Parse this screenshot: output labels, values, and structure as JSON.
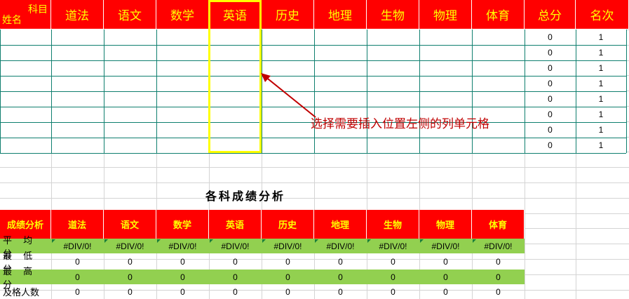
{
  "top_table": {
    "corner_top": "科目",
    "corner_bottom": "姓名",
    "headers": [
      "道法",
      "语文",
      "数学",
      "英语",
      "历史",
      "地理",
      "生物",
      "物理",
      "体育",
      "总分",
      "名次"
    ],
    "rows": [
      {
        "total": "0",
        "rank": "1"
      },
      {
        "total": "0",
        "rank": "1"
      },
      {
        "total": "0",
        "rank": "1"
      },
      {
        "total": "0",
        "rank": "1"
      },
      {
        "total": "0",
        "rank": "1"
      },
      {
        "total": "0",
        "rank": "1"
      },
      {
        "total": "0",
        "rank": "1"
      },
      {
        "total": "0",
        "rank": "1"
      }
    ]
  },
  "annotation": {
    "text": "选择需要插入位置左侧的列单元格",
    "color": "#c00000"
  },
  "analysis": {
    "title": "各科成绩分析",
    "header_label": "成绩分析",
    "subjects": [
      "道法",
      "语文",
      "数学",
      "英语",
      "历史",
      "地理",
      "生物",
      "物理",
      "体育"
    ],
    "rows": [
      {
        "label": "平 均 分",
        "values": [
          "#DIV/0!",
          "#DIV/0!",
          "#DIV/0!",
          "#DIV/0!",
          "#DIV/0!",
          "#DIV/0!",
          "#DIV/0!",
          "#DIV/0!",
          "#DIV/0!"
        ]
      },
      {
        "label": "最 低 分",
        "values": [
          "0",
          "0",
          "0",
          "0",
          "0",
          "0",
          "0",
          "0",
          "0"
        ]
      },
      {
        "label": "最 高 分",
        "values": [
          "0",
          "0",
          "0",
          "0",
          "0",
          "0",
          "0",
          "0",
          "0"
        ]
      },
      {
        "label": "及格人数",
        "values": [
          "0",
          "0",
          "0",
          "0",
          "0",
          "0",
          "0",
          "0",
          "0"
        ]
      }
    ]
  },
  "colors": {
    "header_bg": "#ff0000",
    "header_text": "#ffff00",
    "highlight_border": "#ffff00",
    "green_row": "#92d050",
    "arrow": "#c00000"
  }
}
